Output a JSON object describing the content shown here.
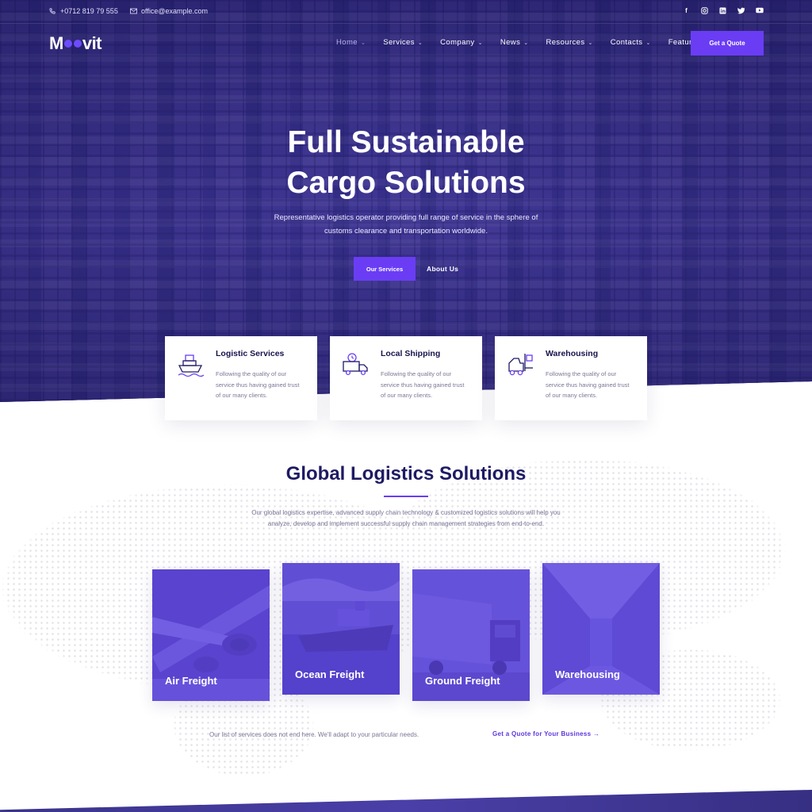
{
  "topbar": {
    "phone": "+0712 819 79 555",
    "email": "office@example.com",
    "socials": [
      "facebook-icon",
      "instagram-icon",
      "linkedin-icon",
      "twitter-icon",
      "youtube-icon"
    ]
  },
  "header": {
    "logo_start": "M",
    "logo_end": "vit",
    "nav": [
      {
        "label": "Home",
        "active": true
      },
      {
        "label": "Services"
      },
      {
        "label": "Company"
      },
      {
        "label": "News"
      },
      {
        "label": "Resources"
      },
      {
        "label": "Contacts"
      },
      {
        "label": "Features"
      }
    ],
    "quote_label": "Get a Quote"
  },
  "hero": {
    "title_line1": "Full Sustainable",
    "title_line2": "Cargo Solutions",
    "subtitle_line1": "Representative logistics operator providing full range of service in the sphere of",
    "subtitle_line2": "customs clearance and transportation worldwide.",
    "primary_button": "Our Services",
    "secondary_link": "About Us"
  },
  "features": [
    {
      "title": "Logistic Services",
      "text": "Following the quality of our service thus having gained trust of our many clients.",
      "icon": "ship-icon"
    },
    {
      "title": "Local Shipping",
      "text": "Following the quality of our service thus having gained trust of our many clients.",
      "icon": "truck-clock-icon"
    },
    {
      "title": "Warehousing",
      "text": "Following the quality of our service thus having gained trust of our many clients.",
      "icon": "forklift-icon"
    }
  ],
  "solutions": {
    "title": "Global Logistics Solutions",
    "desc_line1": "Our global logistics expertise, advanced supply chain technology & customized logistics solutions will help you",
    "desc_line2": "analyze, develop and implement successful supply chain management strategies from end-to-end.",
    "cards": [
      {
        "label": "Air Freight"
      },
      {
        "label": "Ocean Freight"
      },
      {
        "label": "Ground Freight"
      },
      {
        "label": "Warehousing"
      }
    ],
    "footer_note": "Our list of services does not end here. We'll adapt to your particular needs.",
    "footer_link": "Get a Quote for Your Business →"
  },
  "colors": {
    "accent": "#6a3df5",
    "heading": "#1e1a63",
    "hero_overlay": "#3b3487"
  }
}
